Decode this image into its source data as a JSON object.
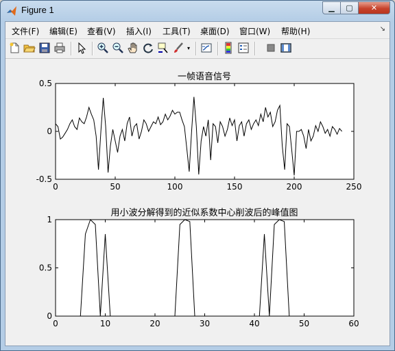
{
  "window": {
    "title": "Figure 1"
  },
  "menu": {
    "items": [
      "文件(F)",
      "编辑(E)",
      "查看(V)",
      "插入(I)",
      "工具(T)",
      "桌面(D)",
      "窗口(W)",
      "帮助(H)"
    ]
  },
  "toolbar": {
    "icons": [
      "new-file-icon",
      "open-folder-icon",
      "save-icon",
      "print-icon",
      "pointer-icon",
      "zoom-in-icon",
      "zoom-out-icon",
      "pan-hand-icon",
      "rotate-3d-icon",
      "data-cursor-icon",
      "brush-icon",
      "link-plot-icon",
      "colorbar-icon",
      "legend-icon",
      "hide-plot-tools-icon",
      "show-plot-tools-icon"
    ]
  },
  "chart_data": [
    {
      "type": "line",
      "title": "一帧语音信号",
      "xlim": [
        0,
        250
      ],
      "ylim": [
        -0.5,
        0.5
      ],
      "xticks": [
        "0",
        "50",
        "100",
        "150",
        "200",
        "250"
      ],
      "yticks": [
        "0.5",
        "0",
        "-0.5"
      ],
      "series": [
        {
          "x": [
            0,
            2,
            4,
            6,
            8,
            10,
            12,
            14,
            16,
            18,
            20,
            22,
            24,
            26,
            28,
            30,
            32,
            34,
            36,
            38,
            40,
            42,
            44,
            46,
            48,
            50,
            52,
            54,
            56,
            58,
            60,
            62,
            64,
            66,
            68,
            70,
            72,
            74,
            76,
            78,
            80,
            82,
            84,
            86,
            88,
            90,
            92,
            94,
            96,
            98,
            100,
            102,
            104,
            106,
            108,
            110,
            112,
            114,
            116,
            118,
            120,
            122,
            124,
            126,
            128,
            130,
            132,
            134,
            136,
            138,
            140,
            142,
            144,
            146,
            148,
            150,
            152,
            154,
            156,
            158,
            160,
            162,
            164,
            166,
            168,
            170,
            172,
            174,
            176,
            178,
            180,
            182,
            184,
            186,
            188,
            190,
            192,
            194,
            196,
            198,
            200,
            202,
            204,
            206,
            208,
            210,
            212,
            214,
            216,
            218,
            220,
            222,
            224,
            226,
            228,
            230,
            232,
            234,
            236,
            238,
            240
          ],
          "y": [
            0.08,
            0.05,
            -0.08,
            -0.06,
            -0.02,
            0.02,
            0.08,
            0.12,
            0.05,
            0.02,
            0.14,
            0.1,
            0.08,
            0.15,
            0.25,
            0.18,
            0.12,
            -0.05,
            -0.4,
            0.0,
            0.35,
            0.05,
            -0.43,
            -0.15,
            0.02,
            -0.1,
            -0.22,
            -0.05,
            0.02,
            -0.1,
            0.08,
            0.15,
            -0.05,
            0.05,
            0.08,
            -0.08,
            0.0,
            0.12,
            0.08,
            0.0,
            0.05,
            0.1,
            0.08,
            0.15,
            0.07,
            0.1,
            0.18,
            0.12,
            0.16,
            0.22,
            0.18,
            0.2,
            0.2,
            0.12,
            0.05,
            -0.18,
            -0.42,
            0.0,
            0.36,
            0.05,
            -0.45,
            -0.1,
            0.05,
            -0.05,
            0.12,
            -0.3,
            0.08,
            0.05,
            -0.12,
            0.1,
            0.05,
            -0.05,
            0.02,
            0.14,
            0.06,
            0.12,
            -0.1,
            0.06,
            0.1,
            -0.05,
            0.08,
            0.12,
            0.02,
            0.08,
            0.12,
            0.06,
            0.18,
            0.1,
            0.25,
            0.15,
            0.2,
            0.05,
            0.1,
            0.22,
            0.27,
            -0.15,
            -0.4,
            0.08,
            0.05,
            -0.2,
            -0.46,
            0.0,
            0.0,
            0.02,
            -0.05,
            -0.18,
            0.02,
            -0.1,
            -0.05,
            0.06,
            0.0,
            0.1,
            0.05,
            -0.02,
            0.02,
            -0.05,
            0.05,
            0.02,
            -0.03,
            0.03,
            0.0
          ]
        }
      ]
    },
    {
      "type": "line",
      "title": "用小波分解得到的近似系数中心削波后的峰值图",
      "xlim": [
        0,
        60
      ],
      "ylim": [
        0,
        1
      ],
      "xticks": [
        "0",
        "10",
        "20",
        "30",
        "40",
        "50",
        "60"
      ],
      "yticks": [
        "1",
        "0.5",
        "0"
      ],
      "series": [
        {
          "x": [
            0,
            5,
            6,
            7,
            8,
            9,
            10,
            11,
            24,
            25,
            26,
            27,
            28,
            41,
            42,
            43,
            44,
            45,
            46,
            47,
            60
          ],
          "y": [
            0,
            0,
            0.85,
            1,
            0.95,
            0,
            0.85,
            0,
            0,
            0.95,
            1,
            0.98,
            0,
            0,
            0.85,
            0,
            0.95,
            1,
            0.98,
            0,
            0
          ]
        }
      ]
    }
  ]
}
